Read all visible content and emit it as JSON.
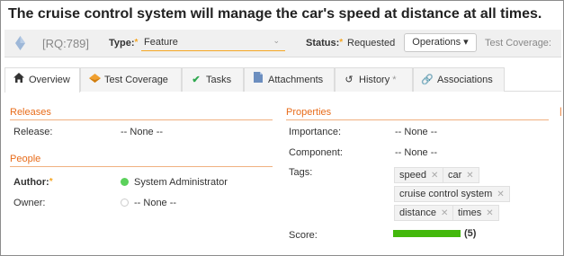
{
  "page_title": "The cruise control system will manage the car's speed at distance at all times.",
  "header": {
    "rq_id": "[RQ:789]",
    "type_label": "Type:",
    "type_value": "Feature",
    "status_label": "Status:",
    "status_value": "Requested",
    "operations_label": "Operations",
    "test_coverage_label": "Test Coverage:"
  },
  "tabs": [
    {
      "label": "Overview",
      "icon": "home-icon"
    },
    {
      "label": "Test Coverage",
      "icon": "test-icon"
    },
    {
      "label": "Tasks",
      "icon": "check-icon"
    },
    {
      "label": "Attachments",
      "icon": "document-icon"
    },
    {
      "label": "History",
      "icon": "history-icon",
      "suffix": "*"
    },
    {
      "label": "Associations",
      "icon": "link-icon"
    }
  ],
  "releases": {
    "section_title": "Releases",
    "release_label": "Release:",
    "release_value": "-- None --"
  },
  "people": {
    "section_title": "People",
    "author_label": "Author:",
    "author_value": "System Administrator",
    "owner_label": "Owner:",
    "owner_value": "-- None --"
  },
  "properties": {
    "section_title": "Properties",
    "importance_label": "Importance:",
    "importance_value": "-- None --",
    "component_label": "Component:",
    "component_value": "-- None --",
    "tags_label": "Tags:",
    "tags": [
      "speed",
      "car",
      "cruise control system",
      "distance",
      "times"
    ],
    "score_label": "Score:",
    "score_value": "(5)",
    "score_fill_fraction": 1.0
  },
  "colors": {
    "accent": "#e86c1a",
    "required": "#f5a623",
    "author_dot": "#5bd15b",
    "score_bar": "#43b80c"
  }
}
